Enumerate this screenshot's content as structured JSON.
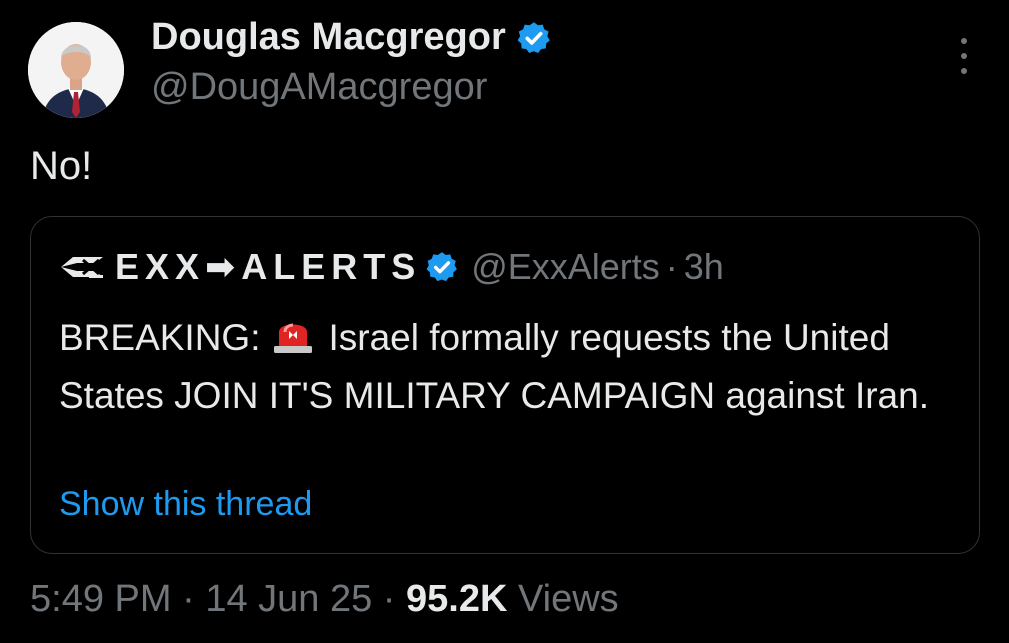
{
  "author": {
    "display_name": "Douglas Macgregor",
    "handle": "@DougAMacgregor",
    "verified": true
  },
  "tweet": {
    "text": "No!"
  },
  "quoted_tweet": {
    "display_name": "EXX➡ALERTS",
    "handle": "@ExxAlerts",
    "separator": "·",
    "time_ago": "3h",
    "verified": true,
    "text_prefix": "BREAKING:",
    "text_main": "Israel formally requests the United States JOIN IT'S MILITARY CAMPAIGN against Iran.",
    "show_thread_label": "Show this thread",
    "logo_text": "EX"
  },
  "meta": {
    "time": "5:49 PM",
    "separator": "·",
    "date": "14 Jun 25",
    "views_count": "95.2K",
    "views_label": "Views"
  },
  "colors": {
    "background": "#000000",
    "primary_text": "#e7e9ea",
    "secondary_text": "#71767b",
    "accent_link": "#1d9bf0",
    "verified_badge": "#1d9bf0",
    "border": "#2f3336"
  },
  "icons": {
    "verified": "verified-badge-icon",
    "more": "more-options-icon",
    "siren": "police-siren-emoji"
  }
}
